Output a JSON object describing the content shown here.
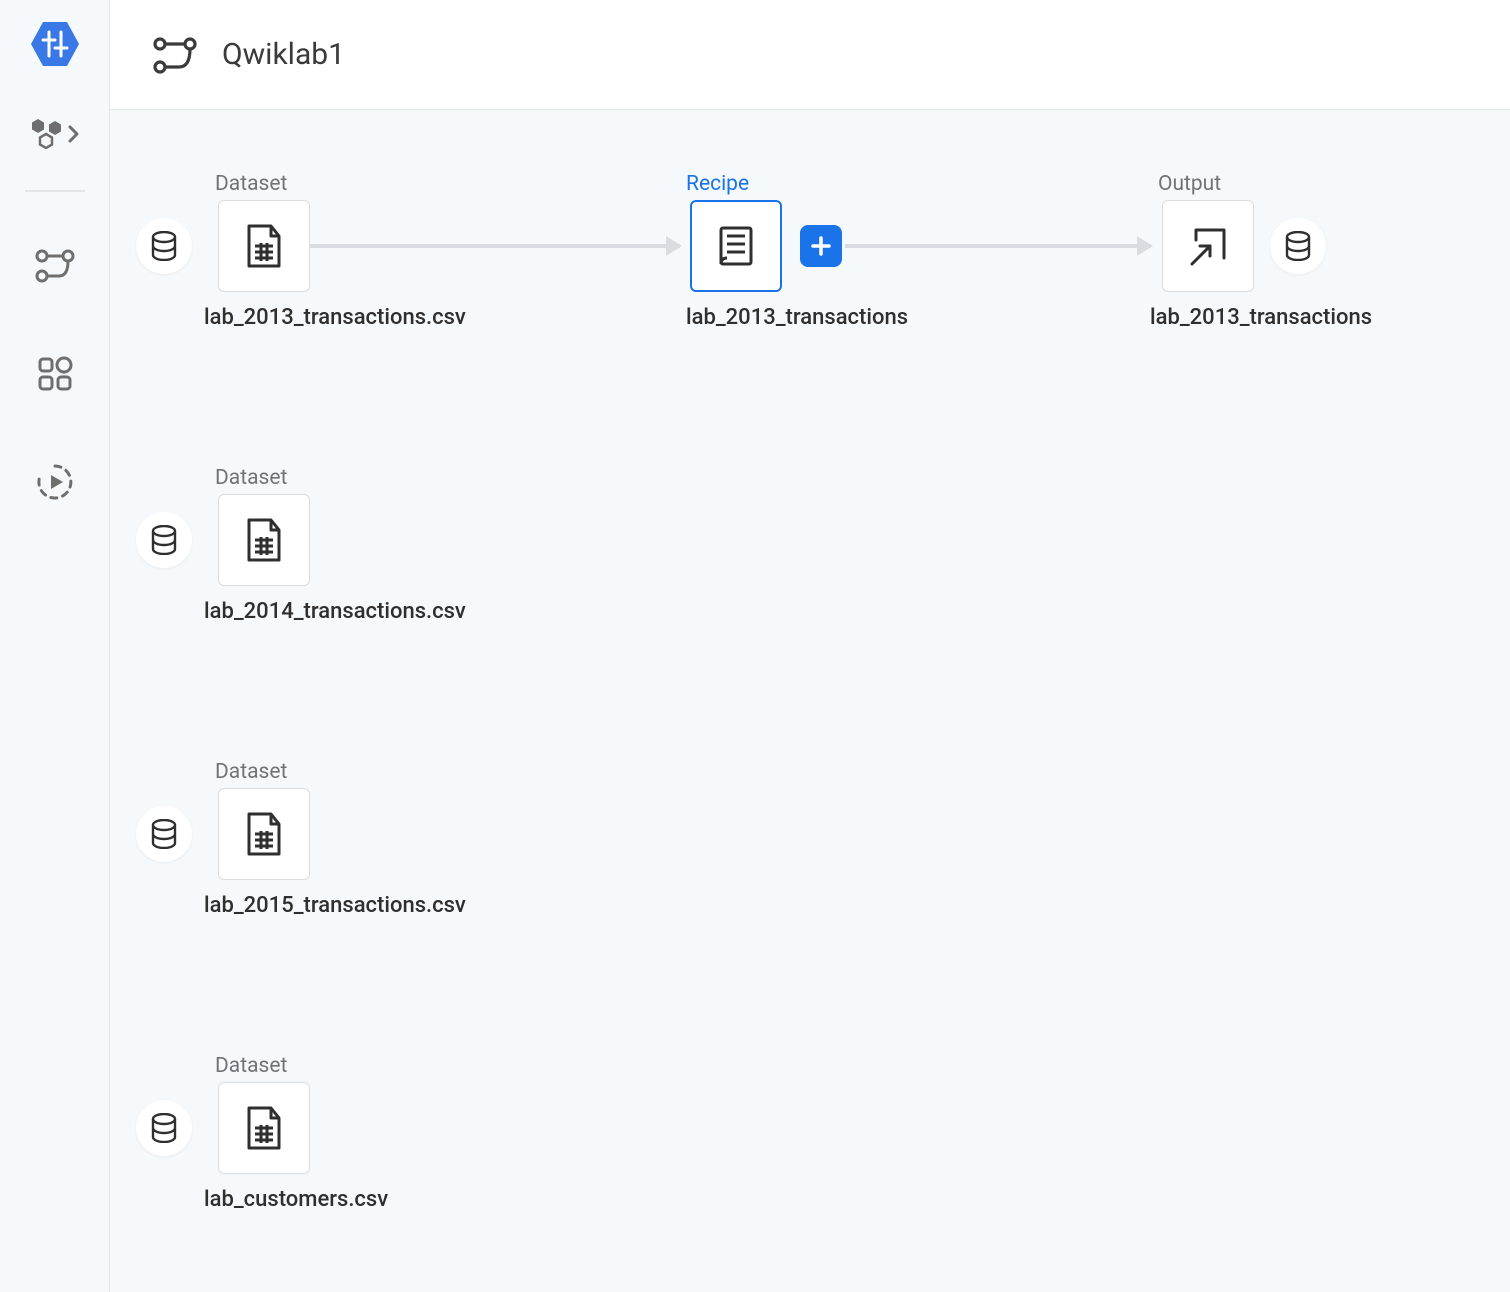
{
  "header": {
    "title": "Qwiklab1"
  },
  "sidebar": {
    "logo": "dataprep-logo",
    "items": [
      {
        "name": "library",
        "icon": "hex-cluster-icon",
        "has_chevron": true
      },
      {
        "name": "flows",
        "icon": "flow-icon"
      },
      {
        "name": "apps",
        "icon": "apps-grid-icon"
      },
      {
        "name": "jobs",
        "icon": "run-circle-icon"
      }
    ]
  },
  "flow": {
    "sections": {
      "dataset": "Dataset",
      "recipe": "Recipe",
      "output": "Output"
    },
    "row1": {
      "dataset_name": "lab_2013_transactions.csv",
      "recipe_name": "lab_2013_transactions",
      "output_name": "lab_2013_transactions"
    },
    "datasets": [
      {
        "label": "lab_2014_transactions.csv"
      },
      {
        "label": "lab_2015_transactions.csv"
      },
      {
        "label": "lab_customers.csv"
      }
    ]
  },
  "colors": {
    "accent": "#1a73e8",
    "bg": "#f6f9fc",
    "border": "#d9dde1",
    "muted": "#6f7479"
  }
}
